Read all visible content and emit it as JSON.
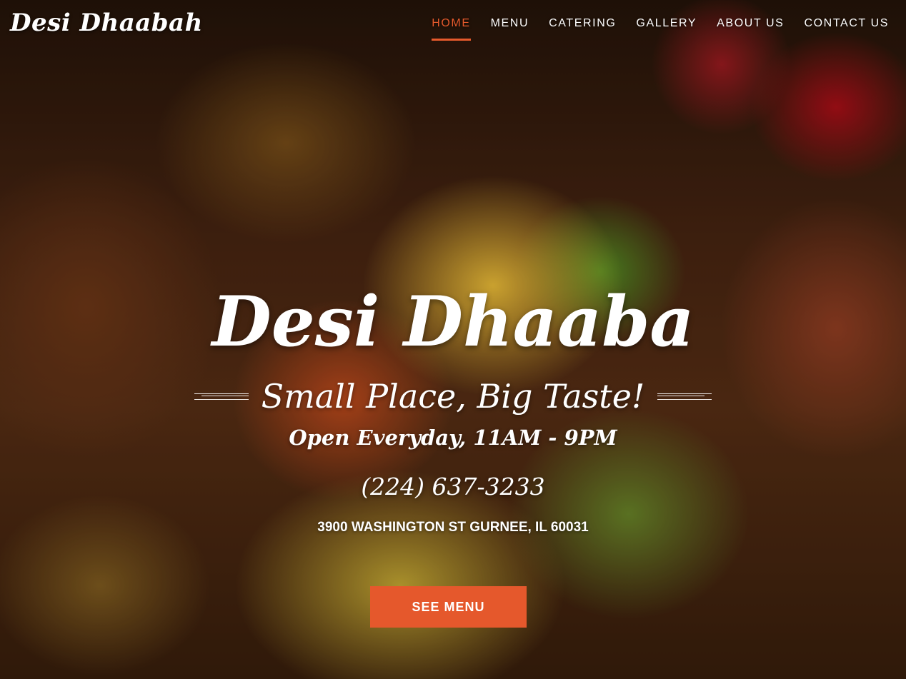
{
  "header": {
    "brand": "Desi Dhaabah",
    "nav": [
      {
        "label": "HOME",
        "active": true
      },
      {
        "label": "MENU",
        "active": false
      },
      {
        "label": "CATERING",
        "active": false
      },
      {
        "label": "GALLERY",
        "active": false
      },
      {
        "label": "ABOUT US",
        "active": false
      },
      {
        "label": "CONTACT US",
        "active": false
      }
    ]
  },
  "hero": {
    "title": "Desi Dhaaba",
    "tagline": "Small Place, Big Taste!",
    "hours": "Open Everyday, 11AM - 9PM",
    "phone": "(224) 637-3233",
    "address": "3900 WASHINGTON ST GURNEE, IL 60031",
    "cta_label": "SEE MENU"
  },
  "colors": {
    "accent": "#e5582c",
    "text": "#ffffff"
  }
}
